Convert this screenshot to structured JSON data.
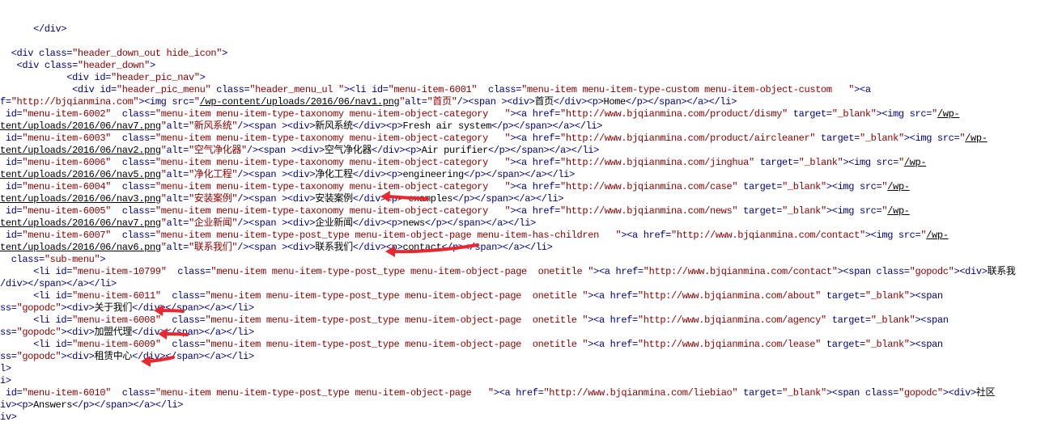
{
  "colors": {
    "tag": "#000080",
    "attr": "#000080",
    "string": "#8b0000",
    "link": "#000000",
    "text": "#000000",
    "annotation_arrow": "#e8282e"
  },
  "lines": [
    [
      {
        "k": "t",
        "v": "      </div>"
      }
    ],
    [
      {
        "k": "x",
        "v": ""
      }
    ],
    [
      {
        "k": "t",
        "v": "  <div "
      },
      {
        "k": "a",
        "v": "class="
      },
      {
        "k": "s",
        "v": "\"header_down_out hide_icon\""
      },
      {
        "k": "t",
        "v": ">"
      }
    ],
    [
      {
        "k": "t",
        "v": "   <div "
      },
      {
        "k": "a",
        "v": "class="
      },
      {
        "k": "s",
        "v": "\"header_down\""
      },
      {
        "k": "t",
        "v": ">"
      }
    ],
    [
      {
        "k": "t",
        "v": "            <div "
      },
      {
        "k": "a",
        "v": "id="
      },
      {
        "k": "s",
        "v": "\"header_pic_nav\""
      },
      {
        "k": "t",
        "v": ">"
      }
    ],
    [
      {
        "k": "t",
        "v": "             <div "
      },
      {
        "k": "a",
        "v": "id="
      },
      {
        "k": "s",
        "v": "\"header_pic_menu\" "
      },
      {
        "k": "a",
        "v": "class="
      },
      {
        "k": "s",
        "v": "\"header_menu_ul \""
      },
      {
        "k": "t",
        "v": "><li "
      },
      {
        "k": "a",
        "v": "id="
      },
      {
        "k": "s",
        "v": "\"menu-item-6001\"  "
      },
      {
        "k": "a",
        "v": "class="
      },
      {
        "k": "s",
        "v": "\"menu-item menu-item-type-custom menu-item-object-custom   \""
      },
      {
        "k": "t",
        "v": "><a"
      }
    ],
    [
      {
        "k": "a",
        "v": "f="
      },
      {
        "k": "s",
        "v": "\"http://bjqianmina.com\""
      },
      {
        "k": "t",
        "v": "><img "
      },
      {
        "k": "a",
        "v": "src="
      },
      {
        "k": "s",
        "v": "\""
      },
      {
        "k": "l",
        "v": "/wp-content/uploads/2016/06/nav1.png"
      },
      {
        "k": "s",
        "v": "\""
      },
      {
        "k": "a",
        "v": "alt="
      },
      {
        "k": "s",
        "v": "\"首页\""
      },
      {
        "k": "t",
        "v": "/><span ><div>"
      },
      {
        "k": "x",
        "v": "首页"
      },
      {
        "k": "t",
        "v": "</div><p>"
      },
      {
        "k": "x",
        "v": "Home"
      },
      {
        "k": "t",
        "v": "</p></span></a></li>"
      }
    ],
    [
      {
        "k": "a",
        "v": " id="
      },
      {
        "k": "s",
        "v": "\"menu-item-6002\"  "
      },
      {
        "k": "a",
        "v": "class="
      },
      {
        "k": "s",
        "v": "\"menu-item menu-item-type-taxonomy menu-item-object-category   \""
      },
      {
        "k": "t",
        "v": "><a "
      },
      {
        "k": "a",
        "v": "href="
      },
      {
        "k": "s",
        "v": "\"http://www.bjqianmina.com/product/dismy\" "
      },
      {
        "k": "a",
        "v": "target="
      },
      {
        "k": "s",
        "v": "\"_blank\""
      },
      {
        "k": "t",
        "v": "><img "
      },
      {
        "k": "a",
        "v": "src="
      },
      {
        "k": "s",
        "v": "\""
      },
      {
        "k": "l",
        "v": "/wp-"
      }
    ],
    [
      {
        "k": "l",
        "v": "tent/uploads/2016/06/nav7.png"
      },
      {
        "k": "s",
        "v": "\""
      },
      {
        "k": "a",
        "v": "alt="
      },
      {
        "k": "s",
        "v": "\"新风系统\""
      },
      {
        "k": "t",
        "v": "/><span ><div>"
      },
      {
        "k": "x",
        "v": "新风系统"
      },
      {
        "k": "t",
        "v": "</div><p>"
      },
      {
        "k": "x",
        "v": "Fresh air system"
      },
      {
        "k": "t",
        "v": "</p></span></a></li>"
      }
    ],
    [
      {
        "k": "a",
        "v": " id="
      },
      {
        "k": "s",
        "v": "\"menu-item-6003\"  "
      },
      {
        "k": "a",
        "v": "class="
      },
      {
        "k": "s",
        "v": "\"menu-item menu-item-type-taxonomy menu-item-object-category   \""
      },
      {
        "k": "t",
        "v": "><a "
      },
      {
        "k": "a",
        "v": "href="
      },
      {
        "k": "s",
        "v": "\"http://www.bjqianmina.com/product/aircleaner\" "
      },
      {
        "k": "a",
        "v": "target="
      },
      {
        "k": "s",
        "v": "\"_blank\""
      },
      {
        "k": "t",
        "v": "><img "
      },
      {
        "k": "a",
        "v": "src="
      },
      {
        "k": "s",
        "v": "\""
      },
      {
        "k": "l",
        "v": "/wp-"
      }
    ],
    [
      {
        "k": "l",
        "v": "tent/uploads/2016/06/nav2.png"
      },
      {
        "k": "s",
        "v": "\""
      },
      {
        "k": "a",
        "v": "alt="
      },
      {
        "k": "s",
        "v": "\"空气净化器\""
      },
      {
        "k": "t",
        "v": "/><span ><div>"
      },
      {
        "k": "x",
        "v": "空气净化器"
      },
      {
        "k": "t",
        "v": "</div><p>"
      },
      {
        "k": "x",
        "v": "Air purifier"
      },
      {
        "k": "t",
        "v": "</p></span></a></li>"
      }
    ],
    [
      {
        "k": "a",
        "v": " id="
      },
      {
        "k": "s",
        "v": "\"menu-item-6006\"  "
      },
      {
        "k": "a",
        "v": "class="
      },
      {
        "k": "s",
        "v": "\"menu-item menu-item-type-taxonomy menu-item-object-category   \""
      },
      {
        "k": "t",
        "v": "><a "
      },
      {
        "k": "a",
        "v": "href="
      },
      {
        "k": "s",
        "v": "\"http://www.bjqianmina.com/jinghua\" "
      },
      {
        "k": "a",
        "v": "target="
      },
      {
        "k": "s",
        "v": "\"_blank\""
      },
      {
        "k": "t",
        "v": "><img "
      },
      {
        "k": "a",
        "v": "src="
      },
      {
        "k": "s",
        "v": "\""
      },
      {
        "k": "l",
        "v": "/wp-"
      }
    ],
    [
      {
        "k": "l",
        "v": "tent/uploads/2016/06/nav5.png"
      },
      {
        "k": "s",
        "v": "\""
      },
      {
        "k": "a",
        "v": "alt="
      },
      {
        "k": "s",
        "v": "\"净化工程\""
      },
      {
        "k": "t",
        "v": "/><span ><div>"
      },
      {
        "k": "x",
        "v": "净化工程"
      },
      {
        "k": "t",
        "v": "</div><p>"
      },
      {
        "k": "x",
        "v": "engineering"
      },
      {
        "k": "t",
        "v": "</p></span></a></li>"
      }
    ],
    [
      {
        "k": "a",
        "v": " id="
      },
      {
        "k": "s",
        "v": "\"menu-item-6004\"  "
      },
      {
        "k": "a",
        "v": "class="
      },
      {
        "k": "s",
        "v": "\"menu-item menu-item-type-taxonomy menu-item-object-category   \""
      },
      {
        "k": "t",
        "v": "><a "
      },
      {
        "k": "a",
        "v": "href="
      },
      {
        "k": "s",
        "v": "\"http://www.bjqianmina.com/case\" "
      },
      {
        "k": "a",
        "v": "target="
      },
      {
        "k": "s",
        "v": "\"_blank\""
      },
      {
        "k": "t",
        "v": "><img "
      },
      {
        "k": "a",
        "v": "src="
      },
      {
        "k": "s",
        "v": "\""
      },
      {
        "k": "l",
        "v": "/wp-"
      }
    ],
    [
      {
        "k": "l",
        "v": "tent/uploads/2016/06/nav3.png"
      },
      {
        "k": "s",
        "v": "\""
      },
      {
        "k": "a",
        "v": "alt="
      },
      {
        "k": "s",
        "v": "\"安装案例\""
      },
      {
        "k": "t",
        "v": "/><span ><div>"
      },
      {
        "k": "x",
        "v": "安装案例"
      },
      {
        "k": "t",
        "v": "</div><p>"
      },
      {
        "k": "x",
        "v": " examples"
      },
      {
        "k": "t",
        "v": "</p></span></a></li>"
      }
    ],
    [
      {
        "k": "a",
        "v": " id="
      },
      {
        "k": "s",
        "v": "\"menu-item-6005\"  "
      },
      {
        "k": "a",
        "v": "class="
      },
      {
        "k": "s",
        "v": "\"menu-item menu-item-type-taxonomy menu-item-object-category   \""
      },
      {
        "k": "t",
        "v": "><a "
      },
      {
        "k": "a",
        "v": "href="
      },
      {
        "k": "s",
        "v": "\"http://www.bjqianmina.com/news\" "
      },
      {
        "k": "a",
        "v": "target="
      },
      {
        "k": "s",
        "v": "\"_blank\""
      },
      {
        "k": "t",
        "v": "><img "
      },
      {
        "k": "a",
        "v": "src="
      },
      {
        "k": "s",
        "v": "\""
      },
      {
        "k": "l",
        "v": "/wp-"
      }
    ],
    [
      {
        "k": "l",
        "v": "tent/uploads/2016/06/nav7.png"
      },
      {
        "k": "s",
        "v": "\""
      },
      {
        "k": "a",
        "v": "alt="
      },
      {
        "k": "s",
        "v": "\"企业新闻\""
      },
      {
        "k": "t",
        "v": "/><span ><div>"
      },
      {
        "k": "x",
        "v": "企业新闻"
      },
      {
        "k": "t",
        "v": "</div><p>"
      },
      {
        "k": "x",
        "v": "news"
      },
      {
        "k": "t",
        "v": "</p></span></a></li>"
      }
    ],
    [
      {
        "k": "a",
        "v": " id="
      },
      {
        "k": "s",
        "v": "\"menu-item-6007\"  "
      },
      {
        "k": "a",
        "v": "class="
      },
      {
        "k": "s",
        "v": "\"menu-item menu-item-type-post_type menu-item-object-page menu-item-has-children   \""
      },
      {
        "k": "t",
        "v": "><a "
      },
      {
        "k": "a",
        "v": "href="
      },
      {
        "k": "s",
        "v": "\"http://www.bjqianmina.com/contact\""
      },
      {
        "k": "t",
        "v": "><img "
      },
      {
        "k": "a",
        "v": "src="
      },
      {
        "k": "s",
        "v": "\""
      },
      {
        "k": "l",
        "v": "/wp-"
      }
    ],
    [
      {
        "k": "l",
        "v": "tent/uploads/2016/06/nav6.png"
      },
      {
        "k": "s",
        "v": "\""
      },
      {
        "k": "a",
        "v": "alt="
      },
      {
        "k": "s",
        "v": "\"联系我们\""
      },
      {
        "k": "t",
        "v": "/><span ><div>"
      },
      {
        "k": "x",
        "v": "联系我们"
      },
      {
        "k": "t",
        "v": "</div><p>"
      },
      {
        "k": "x",
        "v": "contact"
      },
      {
        "k": "t",
        "v": "</p></span></a></li>"
      }
    ],
    [
      {
        "k": "a",
        "v": "  class="
      },
      {
        "k": "s",
        "v": "\"sub-menu\""
      },
      {
        "k": "t",
        "v": ">"
      }
    ],
    [
      {
        "k": "t",
        "v": "      <li "
      },
      {
        "k": "a",
        "v": "id="
      },
      {
        "k": "s",
        "v": "\"menu-item-10799\"  "
      },
      {
        "k": "a",
        "v": "class="
      },
      {
        "k": "s",
        "v": "\"menu-item menu-item-type-post_type menu-item-object-page  onetitle \""
      },
      {
        "k": "t",
        "v": "><a "
      },
      {
        "k": "a",
        "v": "href="
      },
      {
        "k": "s",
        "v": "\"http://www.bjqianmina.com/contact\""
      },
      {
        "k": "t",
        "v": "><span "
      },
      {
        "k": "a",
        "v": "class="
      },
      {
        "k": "s",
        "v": "\"gopodc\""
      },
      {
        "k": "t",
        "v": "><div>"
      },
      {
        "k": "x",
        "v": "联系我"
      }
    ],
    [
      {
        "k": "t",
        "v": "/div></span></a></li>"
      }
    ],
    [
      {
        "k": "t",
        "v": "      <li "
      },
      {
        "k": "a",
        "v": "id="
      },
      {
        "k": "s",
        "v": "\"menu-item-6011\"  "
      },
      {
        "k": "a",
        "v": "class="
      },
      {
        "k": "s",
        "v": "\"menu-item menu-item-type-post_type menu-item-object-page  onetitle \""
      },
      {
        "k": "t",
        "v": "><a "
      },
      {
        "k": "a",
        "v": "href="
      },
      {
        "k": "s",
        "v": "\"http://www.bjqianmina.com/about\" "
      },
      {
        "k": "a",
        "v": "target="
      },
      {
        "k": "s",
        "v": "\"_blank\""
      },
      {
        "k": "t",
        "v": "><span"
      }
    ],
    [
      {
        "k": "a",
        "v": "ss="
      },
      {
        "k": "s",
        "v": "\"gopodc\""
      },
      {
        "k": "t",
        "v": "><div>"
      },
      {
        "k": "x",
        "v": "关于我们"
      },
      {
        "k": "t",
        "v": "</div></span></a></li>"
      }
    ],
    [
      {
        "k": "t",
        "v": "      <li "
      },
      {
        "k": "a",
        "v": "id="
      },
      {
        "k": "s",
        "v": "\"menu-item-6008\"  "
      },
      {
        "k": "a",
        "v": "class="
      },
      {
        "k": "s",
        "v": "\"menu-item menu-item-type-post_type menu-item-object-page  onetitle \""
      },
      {
        "k": "t",
        "v": "><a "
      },
      {
        "k": "a",
        "v": "href="
      },
      {
        "k": "s",
        "v": "\"http://www.bjqianmina.com/agency\" "
      },
      {
        "k": "a",
        "v": "target="
      },
      {
        "k": "s",
        "v": "\"_blank\""
      },
      {
        "k": "t",
        "v": "><span"
      }
    ],
    [
      {
        "k": "a",
        "v": "ss="
      },
      {
        "k": "s",
        "v": "\"gopodc\""
      },
      {
        "k": "t",
        "v": "><div>"
      },
      {
        "k": "x",
        "v": "加盟代理"
      },
      {
        "k": "t",
        "v": "</div></span></a></li>"
      }
    ],
    [
      {
        "k": "t",
        "v": "      <li "
      },
      {
        "k": "a",
        "v": "id="
      },
      {
        "k": "s",
        "v": "\"menu-item-6009\"  "
      },
      {
        "k": "a",
        "v": "class="
      },
      {
        "k": "s",
        "v": "\"menu-item menu-item-type-post_type menu-item-object-page  onetitle \""
      },
      {
        "k": "t",
        "v": "><a "
      },
      {
        "k": "a",
        "v": "href="
      },
      {
        "k": "s",
        "v": "\"http://www.bjqianmina.com/lease\" "
      },
      {
        "k": "a",
        "v": "target="
      },
      {
        "k": "s",
        "v": "\"_blank\""
      },
      {
        "k": "t",
        "v": "><span"
      }
    ],
    [
      {
        "k": "a",
        "v": "ss="
      },
      {
        "k": "s",
        "v": "\"gopodc\""
      },
      {
        "k": "t",
        "v": "><div>"
      },
      {
        "k": "x",
        "v": "租赁中心"
      },
      {
        "k": "t",
        "v": "</div></span></a></li>"
      }
    ],
    [
      {
        "k": "t",
        "v": "l>"
      }
    ],
    [
      {
        "k": "t",
        "v": "i>"
      }
    ],
    [
      {
        "k": "a",
        "v": " id="
      },
      {
        "k": "s",
        "v": "\"menu-item-6010\"  "
      },
      {
        "k": "a",
        "v": "class="
      },
      {
        "k": "s",
        "v": "\"menu-item menu-item-type-post_type menu-item-object-page   \""
      },
      {
        "k": "t",
        "v": "><a "
      },
      {
        "k": "a",
        "v": "href="
      },
      {
        "k": "s",
        "v": "\"http://www.bjqianmina.com/liebiao\" "
      },
      {
        "k": "a",
        "v": "target="
      },
      {
        "k": "s",
        "v": "\"_blank\""
      },
      {
        "k": "t",
        "v": "><span "
      },
      {
        "k": "a",
        "v": "class="
      },
      {
        "k": "s",
        "v": "\"gopodc\""
      },
      {
        "k": "t",
        "v": "><div>"
      },
      {
        "k": "x",
        "v": "社区"
      }
    ],
    [
      {
        "k": "t",
        "v": "iv><p>"
      },
      {
        "k": "x",
        "v": "Answers"
      },
      {
        "k": "t",
        "v": "</p></span></a></li>"
      }
    ],
    [
      {
        "k": "t",
        "v": "iv>"
      }
    ]
  ]
}
